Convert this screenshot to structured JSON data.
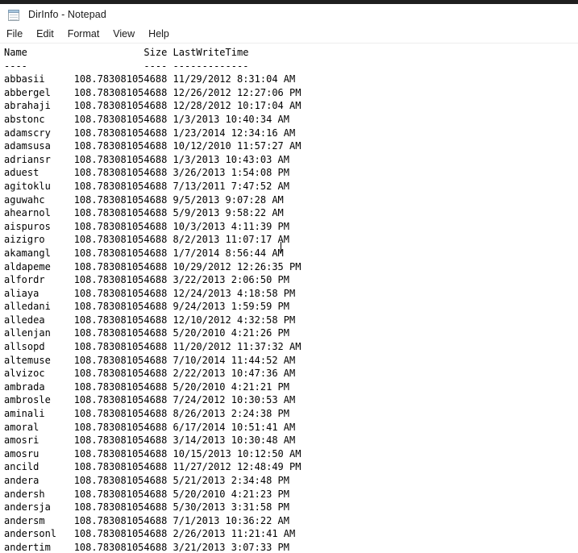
{
  "window": {
    "title": "DirInfo - Notepad",
    "icon": "notepad-icon"
  },
  "menubar": {
    "items": [
      {
        "label": "File"
      },
      {
        "label": "Edit"
      },
      {
        "label": "Format"
      },
      {
        "label": "View"
      },
      {
        "label": "Help"
      }
    ]
  },
  "document": {
    "columns": [
      "Name",
      "Size",
      "LastWriteTime"
    ],
    "separators": [
      "----",
      "----",
      "-------------"
    ],
    "name_width": 9,
    "size_width": 18,
    "rows": [
      {
        "name": "abbasii",
        "size": "108.783081054688",
        "lastwritetime": "11/29/2012 8:31:04 AM"
      },
      {
        "name": "abbergel",
        "size": "108.783081054688",
        "lastwritetime": "12/26/2012 12:27:06 PM"
      },
      {
        "name": "abrahaji",
        "size": "108.783081054688",
        "lastwritetime": "12/28/2012 10:17:04 AM"
      },
      {
        "name": "abstonc",
        "size": "108.783081054688",
        "lastwritetime": "1/3/2013 10:40:34 AM"
      },
      {
        "name": "adamscry",
        "size": "108.783081054688",
        "lastwritetime": "1/23/2014 12:34:16 AM"
      },
      {
        "name": "adamsusa",
        "size": "108.783081054688",
        "lastwritetime": "10/12/2010 11:57:27 AM"
      },
      {
        "name": "adriansr",
        "size": "108.783081054688",
        "lastwritetime": "1/3/2013 10:43:03 AM"
      },
      {
        "name": "aduest",
        "size": "108.783081054688",
        "lastwritetime": "3/26/2013 1:54:08 PM"
      },
      {
        "name": "agitoklu",
        "size": "108.783081054688",
        "lastwritetime": "7/13/2011 7:47:52 AM"
      },
      {
        "name": "aguwahc",
        "size": "108.783081054688",
        "lastwritetime": "9/5/2013 9:07:28 AM"
      },
      {
        "name": "ahearnol",
        "size": "108.783081054688",
        "lastwritetime": "5/9/2013 9:58:22 AM"
      },
      {
        "name": "aispuros",
        "size": "108.783081054688",
        "lastwritetime": "10/3/2013 4:11:39 PM"
      },
      {
        "name": "aizigro",
        "size": "108.783081054688",
        "lastwritetime": "8/2/2013 11:07:17 AM"
      },
      {
        "name": "akamangl",
        "size": "108.783081054688",
        "lastwritetime": "1/7/2014 8:56:44 AM"
      },
      {
        "name": "aldapeme",
        "size": "108.783081054688",
        "lastwritetime": "10/29/2012 12:26:35 PM"
      },
      {
        "name": "alfordr",
        "size": "108.783081054688",
        "lastwritetime": "3/22/2013 2:06:50 PM"
      },
      {
        "name": "aliaya",
        "size": "108.783081054688",
        "lastwritetime": "12/24/2013 4:18:58 PM"
      },
      {
        "name": "alledani",
        "size": "108.783081054688",
        "lastwritetime": "9/24/2013 1:59:59 PM"
      },
      {
        "name": "alledea",
        "size": "108.783081054688",
        "lastwritetime": "12/10/2012 4:32:58 PM"
      },
      {
        "name": "allenjan",
        "size": "108.783081054688",
        "lastwritetime": "5/20/2010 4:21:26 PM"
      },
      {
        "name": "allsopd",
        "size": "108.783081054688",
        "lastwritetime": "11/20/2012 11:37:32 AM"
      },
      {
        "name": "altemuse",
        "size": "108.783081054688",
        "lastwritetime": "7/10/2014 11:44:52 AM"
      },
      {
        "name": "alvizoc",
        "size": "108.783081054688",
        "lastwritetime": "2/22/2013 10:47:36 AM"
      },
      {
        "name": "ambrada",
        "size": "108.783081054688",
        "lastwritetime": "5/20/2010 4:21:21 PM"
      },
      {
        "name": "ambrosle",
        "size": "108.783081054688",
        "lastwritetime": "7/24/2012 10:30:53 AM"
      },
      {
        "name": "aminali",
        "size": "108.783081054688",
        "lastwritetime": "8/26/2013 2:24:38 PM"
      },
      {
        "name": "amoral",
        "size": "108.783081054688",
        "lastwritetime": "6/17/2014 10:51:41 AM"
      },
      {
        "name": "amosri",
        "size": "108.783081054688",
        "lastwritetime": "3/14/2013 10:30:48 AM"
      },
      {
        "name": "amosru",
        "size": "108.783081054688",
        "lastwritetime": "10/15/2013 10:12:50 AM"
      },
      {
        "name": "ancild",
        "size": "108.783081054688",
        "lastwritetime": "11/27/2012 12:48:49 PM"
      },
      {
        "name": "andera",
        "size": "108.783081054688",
        "lastwritetime": "5/21/2013 2:34:48 PM"
      },
      {
        "name": "andersh",
        "size": "108.783081054688",
        "lastwritetime": "5/20/2010 4:21:23 PM"
      },
      {
        "name": "andersja",
        "size": "108.783081054688",
        "lastwritetime": "5/30/2013 3:31:58 PM"
      },
      {
        "name": "andersm",
        "size": "108.783081054688",
        "lastwritetime": "7/1/2013 10:36:22 AM"
      },
      {
        "name": "andersonl",
        "size": "108.783081054688",
        "lastwritetime": "2/26/2013 11:21:41 AM"
      },
      {
        "name": "andertim",
        "size": "108.783081054688",
        "lastwritetime": "3/21/2013 3:07:33 PM"
      }
    ]
  },
  "caret": {
    "visible": true,
    "line_index": 9
  },
  "colors": {
    "window_background": "#ffffff",
    "text": "#000000",
    "top_strip": "#1f1f1f",
    "menu_separator": "#ededed"
  }
}
